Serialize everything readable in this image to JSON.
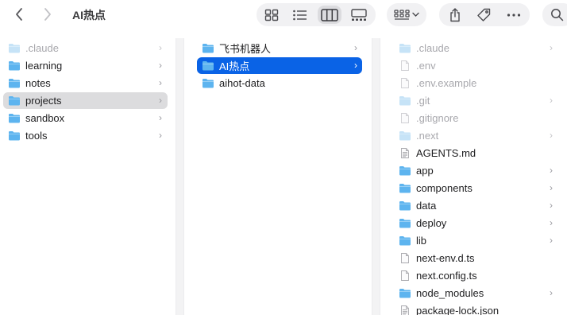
{
  "window": {
    "title": "AI热点"
  },
  "toolbar": {
    "back_icon": "chevron-left-icon",
    "forward_icon": "chevron-right-icon",
    "view_modes": [
      "icon-view",
      "list-view",
      "column-view",
      "gallery-view"
    ],
    "active_view": "column-view"
  },
  "columns": [
    {
      "items": [
        {
          "name": ".claude",
          "kind": "folder",
          "dim": true,
          "chevron": true
        },
        {
          "name": "learning",
          "kind": "folder",
          "dim": false,
          "chevron": true
        },
        {
          "name": "notes",
          "kind": "folder",
          "dim": false,
          "chevron": true
        },
        {
          "name": "projects",
          "kind": "folder",
          "dim": false,
          "chevron": true,
          "selected": "inactive"
        },
        {
          "name": "sandbox",
          "kind": "folder",
          "dim": false,
          "chevron": true
        },
        {
          "name": "tools",
          "kind": "folder",
          "dim": false,
          "chevron": true
        }
      ]
    },
    {
      "items": [
        {
          "name": "飞书机器人",
          "kind": "folder",
          "dim": false,
          "chevron": true
        },
        {
          "name": "AI热点",
          "kind": "folder",
          "dim": false,
          "chevron": true,
          "selected": "active"
        },
        {
          "name": "aihot-data",
          "kind": "folder",
          "dim": false,
          "chevron": false
        }
      ]
    },
    {
      "items": [
        {
          "name": ".claude",
          "kind": "folder",
          "dim": true,
          "chevron": true
        },
        {
          "name": ".env",
          "kind": "file",
          "dim": true,
          "chevron": false
        },
        {
          "name": ".env.example",
          "kind": "file",
          "dim": true,
          "chevron": false
        },
        {
          "name": ".git",
          "kind": "folder",
          "dim": true,
          "chevron": true
        },
        {
          "name": ".gitignore",
          "kind": "file",
          "dim": true,
          "chevron": false
        },
        {
          "name": ".next",
          "kind": "folder",
          "dim": true,
          "chevron": true
        },
        {
          "name": "AGENTS.md",
          "kind": "doc",
          "dim": false,
          "chevron": false
        },
        {
          "name": "app",
          "kind": "folder",
          "dim": false,
          "chevron": true
        },
        {
          "name": "components",
          "kind": "folder",
          "dim": false,
          "chevron": true
        },
        {
          "name": "data",
          "kind": "folder",
          "dim": false,
          "chevron": true
        },
        {
          "name": "deploy",
          "kind": "folder",
          "dim": false,
          "chevron": true
        },
        {
          "name": "lib",
          "kind": "folder",
          "dim": false,
          "chevron": true
        },
        {
          "name": "next-env.d.ts",
          "kind": "file",
          "dim": false,
          "chevron": false
        },
        {
          "name": "next.config.ts",
          "kind": "file",
          "dim": false,
          "chevron": false
        },
        {
          "name": "node_modules",
          "kind": "folder",
          "dim": false,
          "chevron": true
        },
        {
          "name": "package-lock.json",
          "kind": "doc",
          "dim": false,
          "chevron": false
        }
      ]
    }
  ],
  "colors": {
    "folder": "#5db4ef",
    "folder_dim": "#c6e3f7",
    "selection_active": "#0a63e6",
    "selection_inactive": "#dcdcde"
  }
}
